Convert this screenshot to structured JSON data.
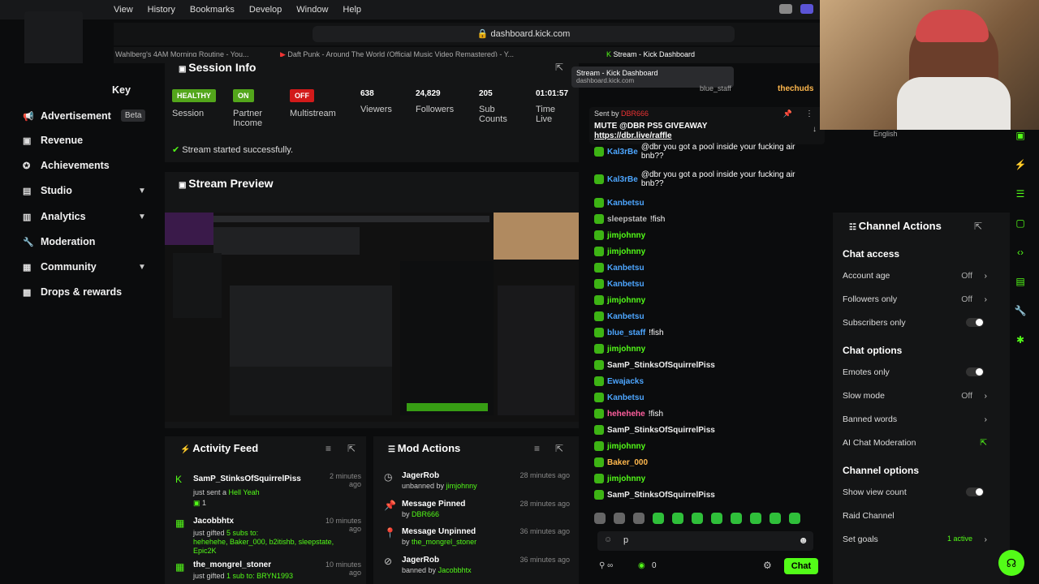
{
  "browser": {
    "menu": [
      "View",
      "History",
      "Bookmarks",
      "Develop",
      "Window",
      "Help"
    ],
    "url": "dashboard.kick.com",
    "tabs": [
      "Wahlberg's 4AM Morning Routine - You...",
      "Daft Punk - Around The World (Official Music Video Remastered) - Y...",
      "Stream - Kick Dashboard"
    ],
    "tooltip_title": "Stream - Kick Dashboard",
    "tooltip_url": "dashboard.kick.com"
  },
  "sidebar": {
    "key_label": "Key",
    "items": [
      {
        "label": "Advertisement",
        "beta": "Beta"
      },
      {
        "label": "Revenue"
      },
      {
        "label": "Achievements"
      },
      {
        "label": "Studio"
      },
      {
        "label": "Analytics"
      },
      {
        "label": "Moderation"
      },
      {
        "label": "Community"
      },
      {
        "label": "Drops & rewards"
      }
    ]
  },
  "session": {
    "title": "Session Info",
    "stats": [
      {
        "value": "HEALTHY",
        "label": "Session"
      },
      {
        "value": "ON",
        "label": "Partner Income"
      },
      {
        "value": "OFF",
        "label": "Multistream"
      },
      {
        "value": "638",
        "label": "Viewers"
      },
      {
        "value": "24,829",
        "label": "Followers"
      },
      {
        "value": "205",
        "label": "Sub Counts"
      },
      {
        "value": "01:01:57",
        "label": "Time Live"
      }
    ],
    "status": "Stream started successfully."
  },
  "preview": {
    "title": "Stream Preview"
  },
  "activity": {
    "title": "Activity Feed",
    "items": [
      {
        "name": "SamP_StinksOfSquirrelPiss",
        "text": "just sent a",
        "highlight": "Hell Yeah",
        "extra": "1",
        "time": "2 minutes ago"
      },
      {
        "name": "Jacobbhtx",
        "text": "just gifted",
        "highlight": "5 subs to:",
        "extra": "hehehehe, Baker_000, b2itishb, sleepstate, Epic2K",
        "time": "10 minutes ago"
      },
      {
        "name": "the_mongrel_stoner",
        "text": "just gifted",
        "highlight": "1 sub to:",
        "extra": "BRYN1993",
        "time": "10 minutes ago"
      }
    ]
  },
  "mod": {
    "title": "Mod Actions",
    "items": [
      {
        "name": "JagerRob",
        "text": "unbanned by",
        "by": "jimjohnny",
        "time": "28 minutes ago"
      },
      {
        "name": "Message Pinned",
        "text": "by",
        "by": "DBR666",
        "time": "28 minutes ago"
      },
      {
        "name": "Message Unpinned",
        "text": "by",
        "by": "the_mongrel_stoner",
        "time": "36 minutes ago"
      },
      {
        "name": "JagerRob",
        "text": "banned by",
        "by": "Jacobbhtx",
        "time": "36 minutes ago"
      }
    ]
  },
  "chat": {
    "pinned_by": "Sent by",
    "pinned_user": "DBR666",
    "pinned_text": "MUTE @DBR PS5 GIVEAWAY",
    "pinned_link": "https://dbr.live/raffle",
    "top_users": [
      "blue_staff",
      "thechuds"
    ],
    "messages": [
      {
        "user": "Kal3rBe",
        "color": "#4da6ff",
        "text": "@dbr you got a pool inside your fucking air bnb??"
      },
      {
        "user": "Kal3rBe",
        "color": "#4da6ff",
        "text": "@dbr you got a pool inside your fucking air bnb??"
      },
      {
        "user": "Kanbetsu",
        "color": "#4da6ff",
        "text": ""
      },
      {
        "user": "sleepstate",
        "color": "#bbbbbb",
        "text": "!fish"
      },
      {
        "user": "jimjohnny",
        "color": "#53fc18",
        "text": ""
      },
      {
        "user": "jimjohnny",
        "color": "#53fc18",
        "text": ""
      },
      {
        "user": "Kanbetsu",
        "color": "#4da6ff",
        "text": ""
      },
      {
        "user": "Kanbetsu",
        "color": "#4da6ff",
        "text": ""
      },
      {
        "user": "jimjohnny",
        "color": "#53fc18",
        "text": ""
      },
      {
        "user": "Kanbetsu",
        "color": "#4da6ff",
        "text": ""
      },
      {
        "user": "blue_staff",
        "color": "#4da6ff",
        "text": "!fish"
      },
      {
        "user": "jimjohnny",
        "color": "#53fc18",
        "text": ""
      },
      {
        "user": "SamP_StinksOfSquirrelPiss",
        "color": "#eeeeee",
        "text": ""
      },
      {
        "user": "Ewajacks",
        "color": "#4da6ff",
        "text": ""
      },
      {
        "user": "Kanbetsu",
        "color": "#4da6ff",
        "text": ""
      },
      {
        "user": "hehehehe",
        "color": "#ff5f9e",
        "text": "!fish"
      },
      {
        "user": "SamP_StinksOfSquirrelPiss",
        "color": "#eeeeee",
        "text": ""
      },
      {
        "user": "jimjohnny",
        "color": "#53fc18",
        "text": ""
      },
      {
        "user": "Baker_000",
        "color": "#ffb84d",
        "text": ""
      },
      {
        "user": "jimjohnny",
        "color": "#53fc18",
        "text": ""
      },
      {
        "user": "SamP_StinksOfSquirrelPiss",
        "color": "#eeeeee",
        "text": ""
      }
    ],
    "input_value": "p",
    "count": "0",
    "send_label": "Chat"
  },
  "channel": {
    "title": "Channel Actions",
    "sections": [
      {
        "title": "Chat access",
        "rows": [
          {
            "label": "Account age",
            "value": "Off",
            "type": "arrow"
          },
          {
            "label": "Followers only",
            "value": "Off",
            "type": "arrow"
          },
          {
            "label": "Subscribers only",
            "value": "",
            "type": "toggle"
          }
        ]
      },
      {
        "title": "Chat options",
        "rows": [
          {
            "label": "Emotes only",
            "value": "",
            "type": "toggle"
          },
          {
            "label": "Slow mode",
            "value": "Off",
            "type": "arrow"
          },
          {
            "label": "Banned words",
            "value": "",
            "type": "arrow"
          },
          {
            "label": "AI Chat Moderation",
            "value": "",
            "type": "link"
          }
        ]
      },
      {
        "title": "Channel options",
        "rows": [
          {
            "label": "Show view count",
            "value": "",
            "type": "toggle"
          },
          {
            "label": "Raid Channel",
            "value": "",
            "type": "none"
          },
          {
            "label": "Set goals",
            "value": "1 active",
            "type": "arrow"
          }
        ]
      }
    ]
  },
  "webcam": {
    "caption": "English"
  },
  "colors": {
    "accent": "#53fc18",
    "healthy": "#53a61b",
    "off": "#d21a1a"
  }
}
